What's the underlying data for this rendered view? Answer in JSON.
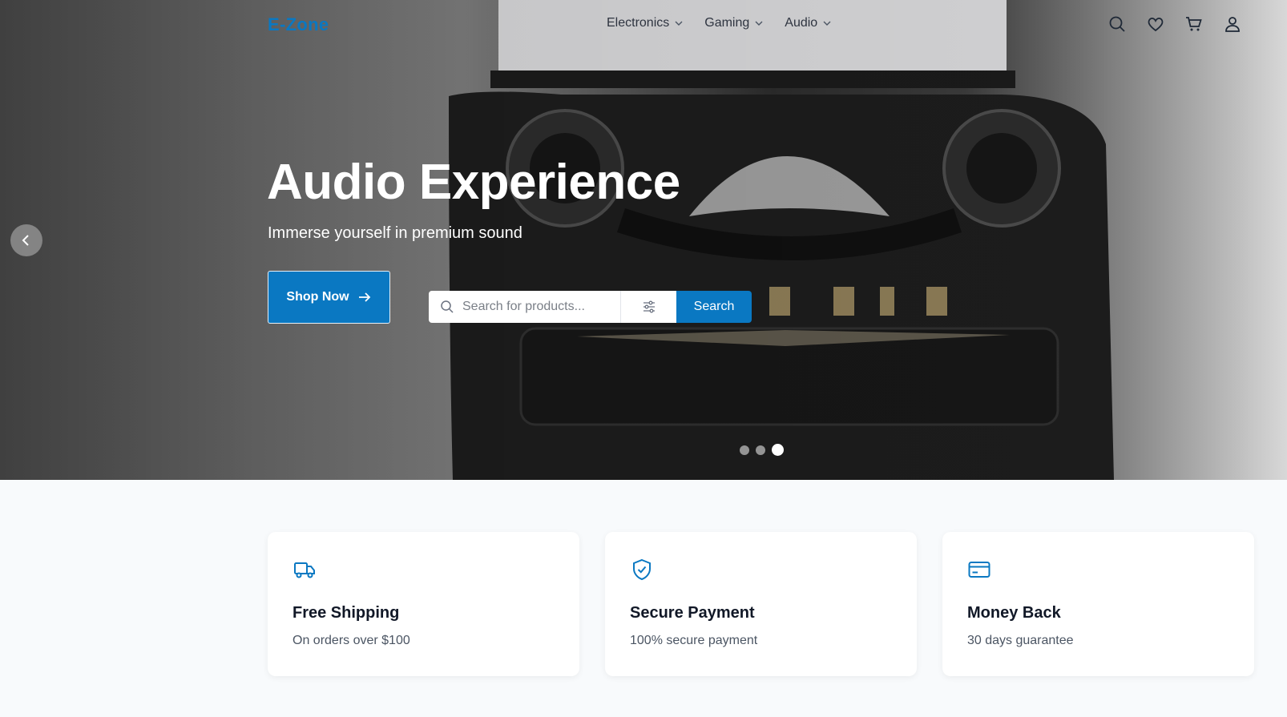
{
  "brand": {
    "logo": "E-Zone",
    "accent": "#0a78c2"
  },
  "nav": {
    "items": [
      {
        "label": "Electronics",
        "icon": "chevron-down-icon"
      },
      {
        "label": "Gaming",
        "icon": "chevron-down-icon"
      },
      {
        "label": "Audio",
        "icon": "chevron-down-icon"
      }
    ],
    "icons": [
      "search-icon",
      "heart-icon",
      "cart-icon",
      "user-icon"
    ]
  },
  "hero": {
    "title": "Audio Experience",
    "subtitle": "Immerse yourself in premium sound",
    "cta_label": "Shop Now",
    "search": {
      "placeholder": "Search for products...",
      "value": "",
      "button_label": "Search"
    },
    "slides": {
      "count": 3,
      "active_index": 2
    }
  },
  "features": [
    {
      "title": "Free Shipping",
      "text": "On orders over $100",
      "icon": "truck-icon"
    },
    {
      "title": "Secure Payment",
      "text": "100% secure payment",
      "icon": "shield-check-icon"
    },
    {
      "title": "Money Back",
      "text": "30 days guarantee",
      "icon": "credit-card-icon"
    }
  ]
}
